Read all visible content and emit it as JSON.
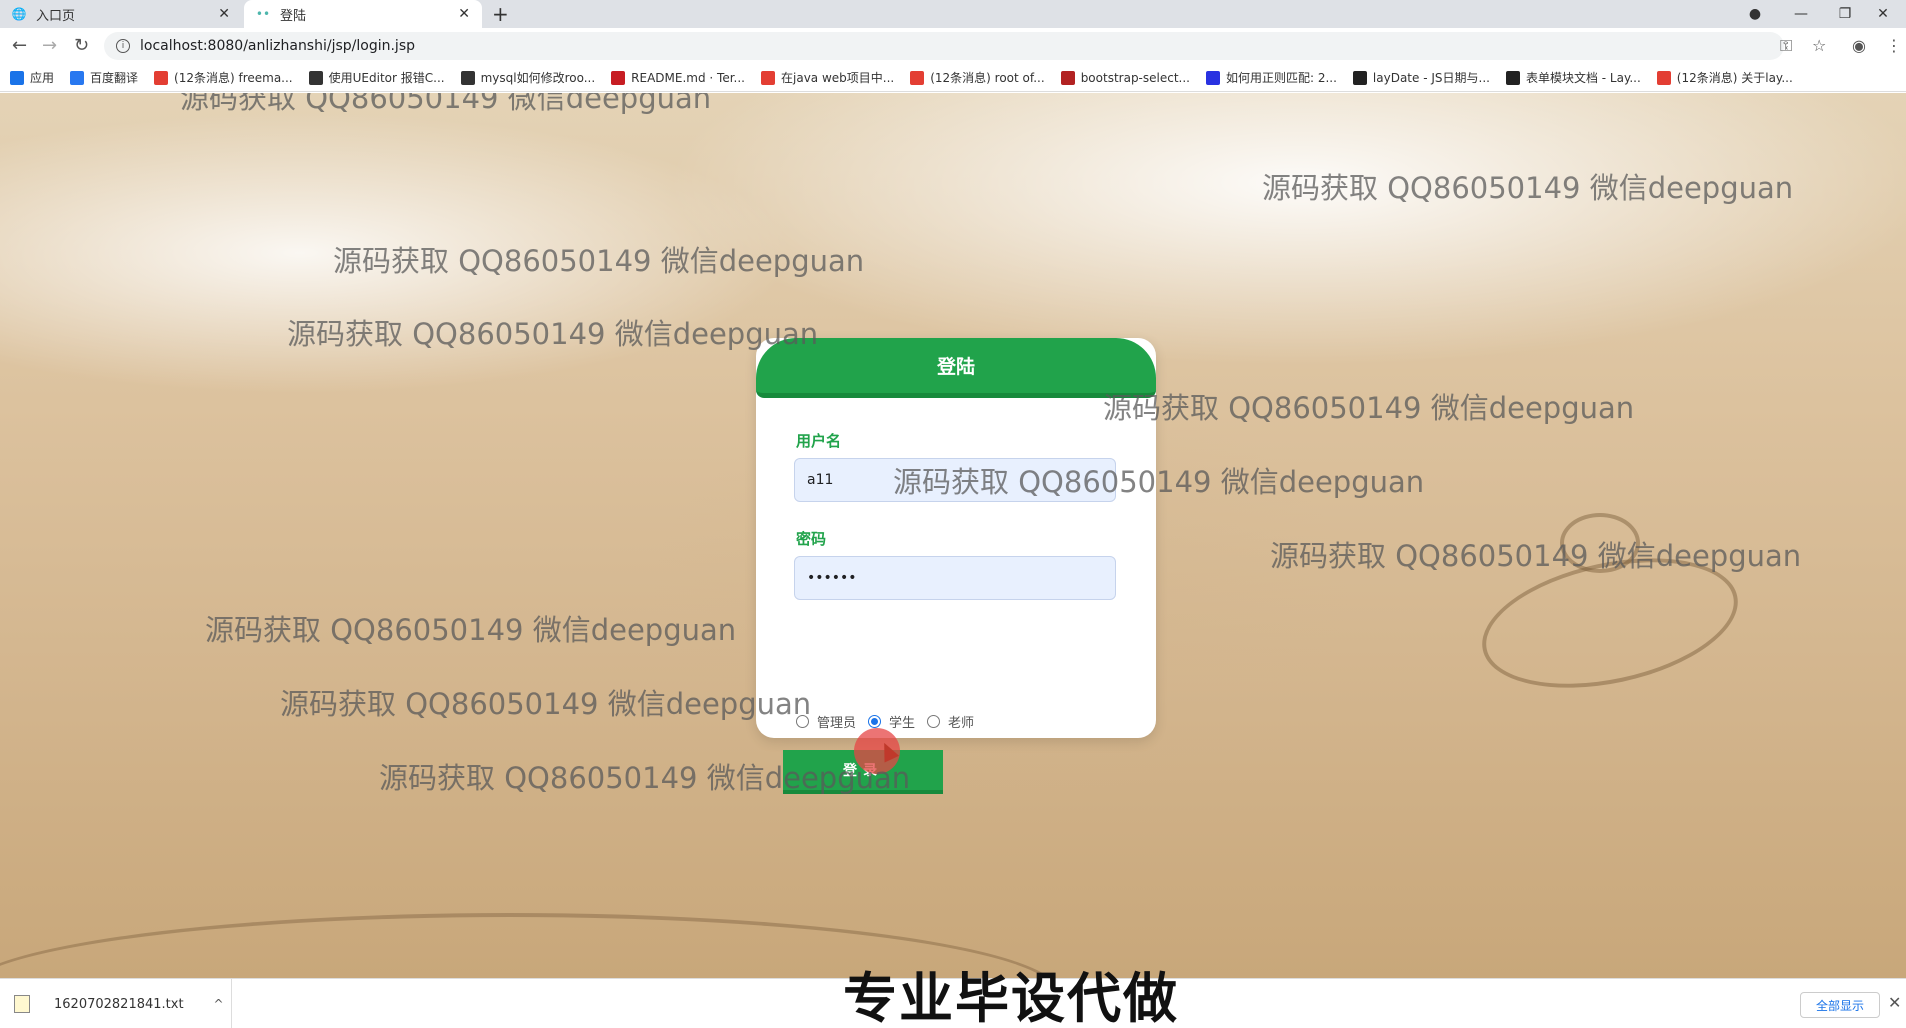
{
  "tabs": [
    {
      "label": "入口页",
      "icon": "globe-icon"
    },
    {
      "label": "登陆",
      "icon": "dots-loading-icon"
    }
  ],
  "address": {
    "url": "localhost:8080/anlizhanshi/jsp/login.jsp"
  },
  "bookmarks": [
    {
      "label": "应用",
      "icon": "apps-grid-icon",
      "color": "#1a73e8"
    },
    {
      "label": "百度翻译",
      "icon": "baidu-translate-icon",
      "color": "#2878f0"
    },
    {
      "label": "(12条消息) freema...",
      "icon": "csdn-icon",
      "color": "#e33e33"
    },
    {
      "label": "使用UEditor 报错C...",
      "icon": "lambda-icon",
      "color": "#333333"
    },
    {
      "label": "mysql如何修改roo...",
      "icon": "lambda-icon",
      "color": "#333333"
    },
    {
      "label": "README.md · Ter...",
      "icon": "gitee-icon",
      "color": "#c71d23"
    },
    {
      "label": "在java web项目中...",
      "icon": "csdn-icon",
      "color": "#e33e33"
    },
    {
      "label": "(12条消息) root of...",
      "icon": "csdn-icon",
      "color": "#e33e33"
    },
    {
      "label": "bootstrap-select...",
      "icon": "cnblogs-icon",
      "color": "#b22222"
    },
    {
      "label": "如何用正则匹配: 2...",
      "icon": "baidu-paw-icon",
      "color": "#2932e1"
    },
    {
      "label": "layDate - JS日期与...",
      "icon": "layui-icon",
      "color": "#222222"
    },
    {
      "label": "表单模块文档 - Lay...",
      "icon": "layui-icon",
      "color": "#222222"
    },
    {
      "label": "(12条消息) 关于lay...",
      "icon": "csdn-icon",
      "color": "#e33e33"
    }
  ],
  "login": {
    "title": "登陆",
    "username_label": "用户名",
    "username_value": "a11",
    "password_label": "密码",
    "password_value": "••••••",
    "roles": [
      {
        "label": "管理员",
        "checked": false
      },
      {
        "label": "学生",
        "checked": true
      },
      {
        "label": "老师",
        "checked": false
      }
    ],
    "submit_label": "登录"
  },
  "watermark": "源码获取 QQ86050149 微信deepguan",
  "banner": "专业毕设代做",
  "download": {
    "filename": "1620702821841.txt",
    "show_all": "全部显示"
  },
  "colors": {
    "accent": "#21a34b",
    "input_bg": "#e8f0fe"
  }
}
